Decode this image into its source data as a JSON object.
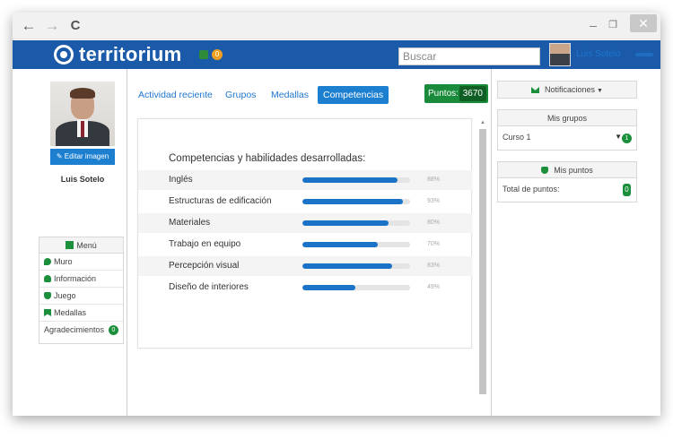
{
  "browser": {
    "back_icon": "←",
    "forward_icon": "→",
    "reload_icon": "C",
    "minimize_icon": "–",
    "restore_icon": "❐",
    "close_icon": "✕"
  },
  "header": {
    "logo_text": "territorium",
    "badge_count": "0",
    "search_placeholder": "Buscar",
    "user_name": "Luis Sotelo"
  },
  "profile": {
    "edit_button": "Editar imagen",
    "name": "Luis Sotelo"
  },
  "menu": {
    "title": "Menú",
    "items": [
      {
        "label": "Muro",
        "icon": "chat-bubble-icon"
      },
      {
        "label": "Información",
        "icon": "person-icon"
      },
      {
        "label": "Juego",
        "icon": "trophy-icon"
      },
      {
        "label": "Medallas",
        "icon": "bookmark-icon"
      },
      {
        "label": "Agradecimientos",
        "icon": "",
        "count": "0"
      }
    ]
  },
  "tabs": [
    {
      "label": "Actividad reciente",
      "active": false
    },
    {
      "label": "Grupos",
      "active": false
    },
    {
      "label": "Medallas",
      "active": false
    },
    {
      "label": "Competencias",
      "active": true
    }
  ],
  "points": {
    "label": "Puntos:",
    "value": "3670"
  },
  "competencies": {
    "title": "Competencias y habilidades desarrolladas:",
    "skills": [
      {
        "name": "Inglés",
        "percent": 88,
        "percent_label": "88%"
      },
      {
        "name": "Estructuras de edificación",
        "percent": 93,
        "percent_label": "93%"
      },
      {
        "name": "Materiales",
        "percent": 80,
        "percent_label": "80%"
      },
      {
        "name": "Trabajo en equipo",
        "percent": 70,
        "percent_label": "70%"
      },
      {
        "name": "Percepción visual",
        "percent": 83,
        "percent_label": "83%"
      },
      {
        "name": "Diseño de interiores",
        "percent": 49,
        "percent_label": "49%"
      }
    ]
  },
  "right": {
    "notifications_label": "Notificaciones",
    "groups_title": "Mis grupos",
    "group_name": "Curso 1",
    "group_count": "1",
    "points_title": "Mis puntos",
    "points_total_label": "Total de puntos:",
    "points_total_value": "0"
  },
  "colors": {
    "header_blue": "#1a5aa8",
    "accent_blue": "#1d7fd0",
    "progress_blue": "#1a73c7",
    "green": "#1b8f3c"
  }
}
